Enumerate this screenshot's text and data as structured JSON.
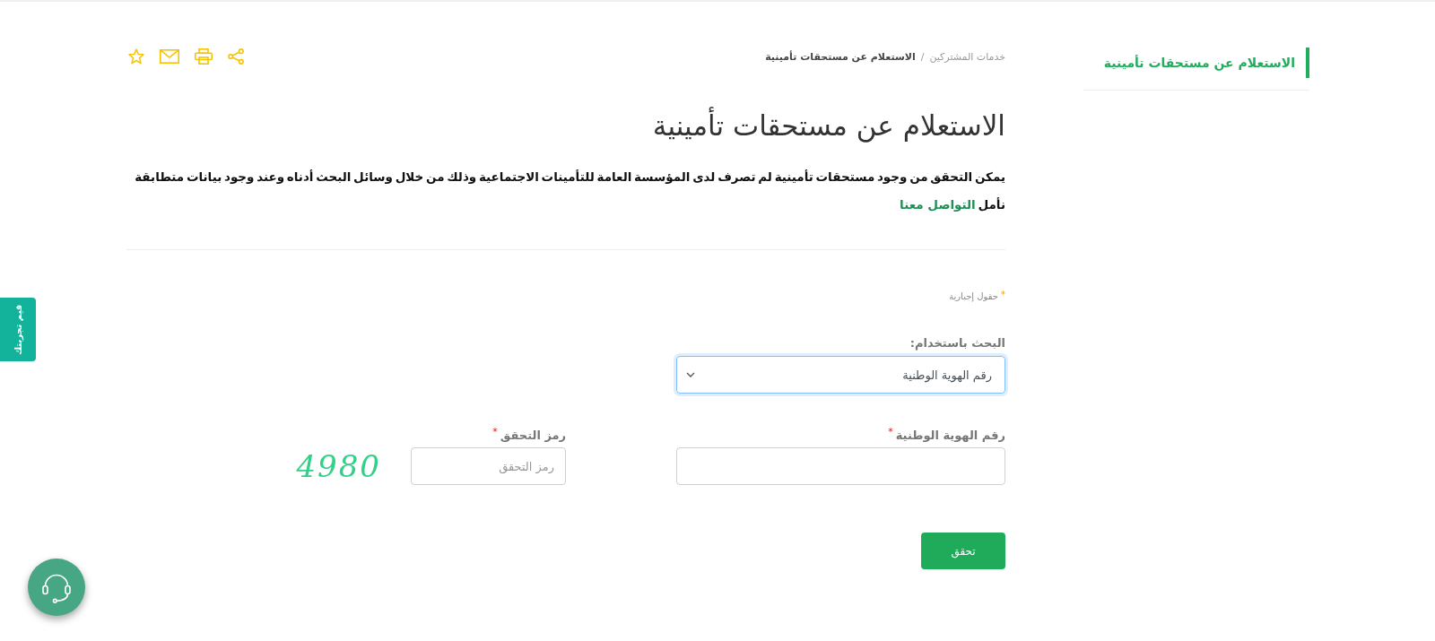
{
  "sidebar": {
    "items": [
      {
        "label": "الاستعلام عن مستحقات تأمينية",
        "selected": true
      }
    ]
  },
  "breadcrumb": {
    "separator": "/",
    "items": [
      {
        "label": "خدمات المشتركين",
        "current": false
      },
      {
        "label": "الاستعلام عن مستحقات تأمينية",
        "current": true
      }
    ]
  },
  "page": {
    "title": "الاستعلام عن مستحقات تأمينية",
    "description": "يمكن التحقق من وجود مستحقات تأمينية لم تصرف لدى المؤسسة العامة للتأمينات الاجتماعية وذلك من خلال وسائل البحث أدناه وعند وجود بيانات متطابقة نأمل",
    "contact_link": "التواصل معنا"
  },
  "form": {
    "required_note": {
      "mark": "*",
      "text": "حقول إجبارية"
    },
    "search_by": {
      "label": "البحث باستخدام:",
      "value": "رقم الهوية الوطنية",
      "focused": true
    },
    "fields": [
      {
        "kind": "text",
        "label": "رقم الهوية الوطنية",
        "required_mark": "*"
      },
      {
        "kind": "captcha",
        "label": "رمز التحقق",
        "required_mark": "*",
        "placeholder": "رمز التحقق",
        "code": "4980"
      }
    ],
    "submit": "تحقق"
  },
  "feedback_tab": {
    "label": "قيم تجربتك"
  }
}
